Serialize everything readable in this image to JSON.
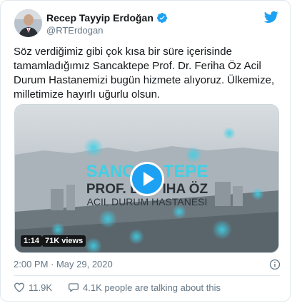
{
  "user": {
    "display_name": "Recep Tayyip Erdoğan",
    "handle": "@RTErdogan"
  },
  "tweet": {
    "text": "Söz verdiğimiz gibi çok kısa bir süre içerisinde tamamladığımız Sancaktepe Prof. Dr. Feriha Öz Acil Durum Hastanemizi bugün hizmete alıyoruz. Ülkemize, milletimize hayırlı uğurlu olsun."
  },
  "video": {
    "overlay_line1": "SANC      TEPE",
    "overlay_line2": "PROF. D      IHA ÖZ",
    "overlay_line3": "ACIL DURUM HASTANESI",
    "duration": "1:14",
    "views": "71K views"
  },
  "meta": {
    "timestamp": "2:00 PM · May 29, 2020"
  },
  "actions": {
    "likes": "11.9K",
    "talking": "4.1K people are talking about this"
  },
  "colors": {
    "accent": "#1da1f2",
    "text": "#14171a",
    "muted": "#657786"
  }
}
